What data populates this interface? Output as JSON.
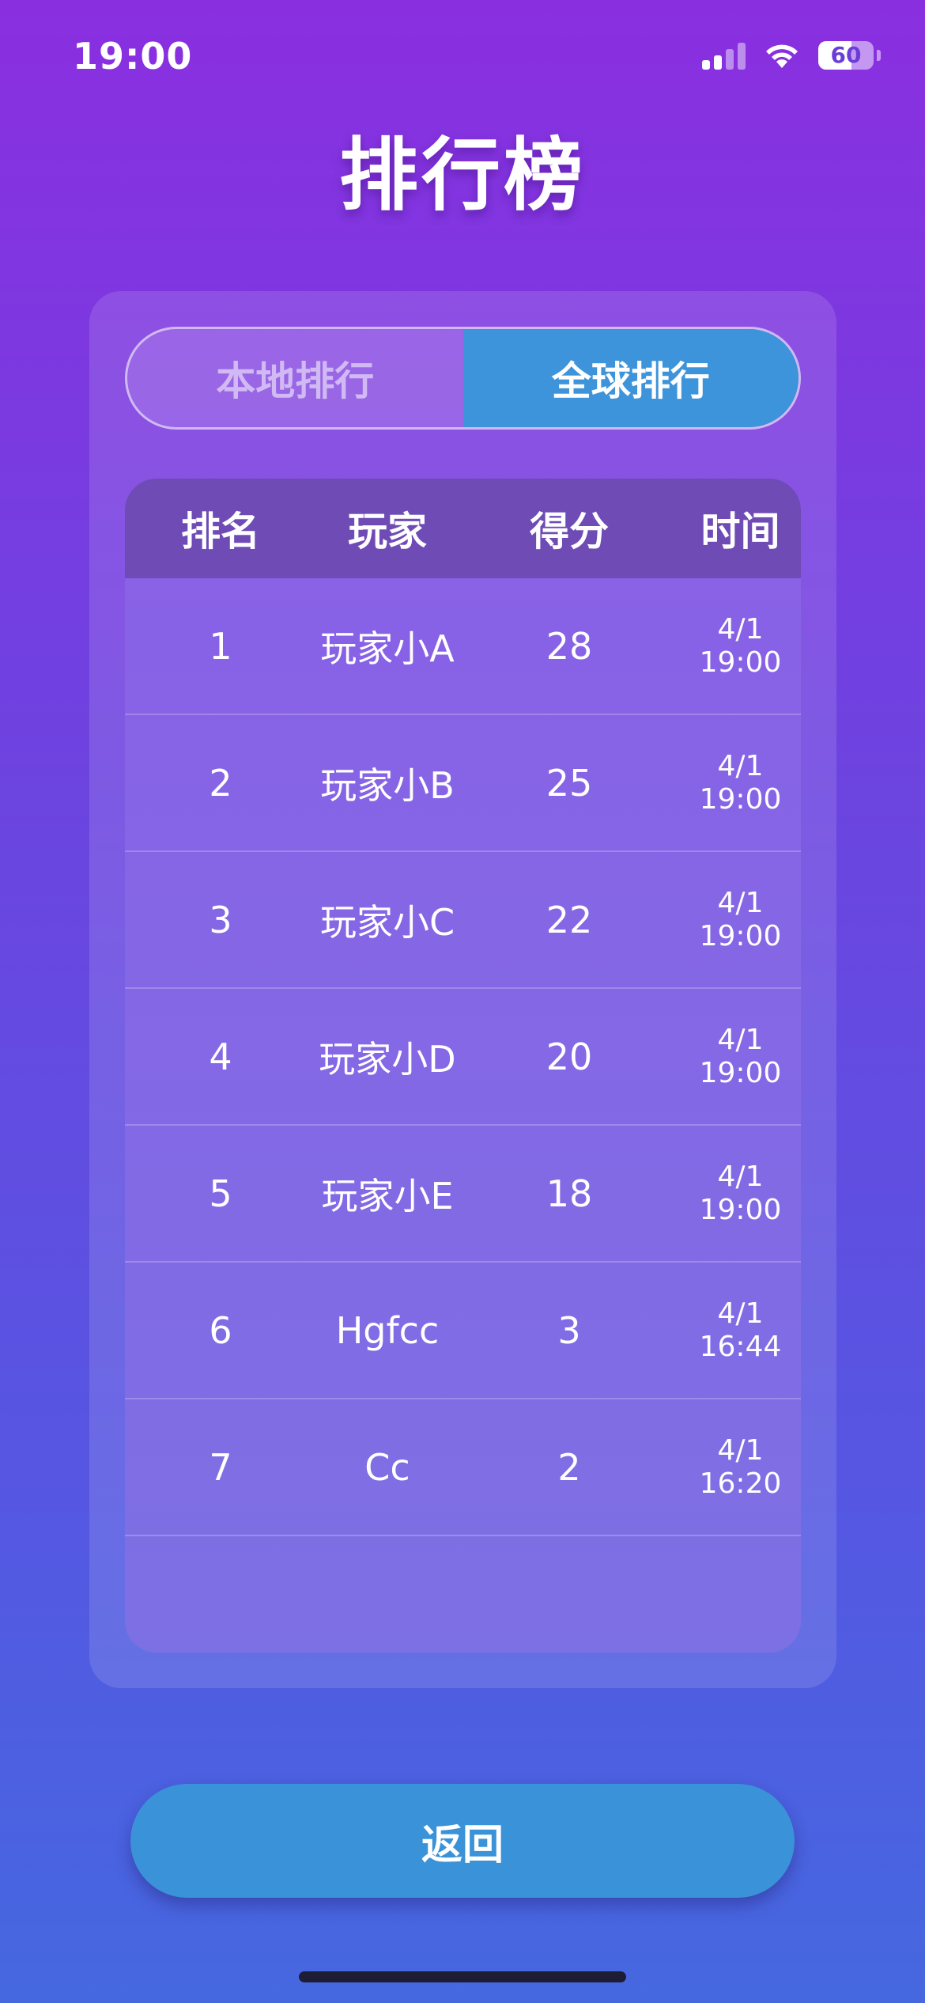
{
  "status_bar": {
    "time": "19:00",
    "battery": "60",
    "icons": [
      "signal-icon",
      "wifi-icon",
      "battery-icon"
    ]
  },
  "title": "排行榜",
  "tabs": [
    {
      "label": "本地排行",
      "active": false
    },
    {
      "label": "全球排行",
      "active": true
    }
  ],
  "table": {
    "headers": {
      "rank": "排名",
      "player": "玩家",
      "score": "得分",
      "time": "时间"
    },
    "rows": [
      {
        "rank": "1",
        "player": "玩家小A",
        "score": "28",
        "date": "4/1",
        "time": "19:00"
      },
      {
        "rank": "2",
        "player": "玩家小B",
        "score": "25",
        "date": "4/1",
        "time": "19:00"
      },
      {
        "rank": "3",
        "player": "玩家小C",
        "score": "22",
        "date": "4/1",
        "time": "19:00"
      },
      {
        "rank": "4",
        "player": "玩家小D",
        "score": "20",
        "date": "4/1",
        "time": "19:00"
      },
      {
        "rank": "5",
        "player": "玩家小E",
        "score": "18",
        "date": "4/1",
        "time": "19:00"
      },
      {
        "rank": "6",
        "player": "Hgfcc",
        "score": "3",
        "date": "4/1",
        "time": "16:44"
      },
      {
        "rank": "7",
        "player": "Cc",
        "score": "2",
        "date": "4/1",
        "time": "16:20"
      }
    ]
  },
  "back_button": {
    "label": "返回"
  },
  "colors": {
    "background_top": "#8a2fe0",
    "background_bottom": "#4568e0",
    "accent": "#3d94da",
    "table_header": "#6f4bb5"
  }
}
